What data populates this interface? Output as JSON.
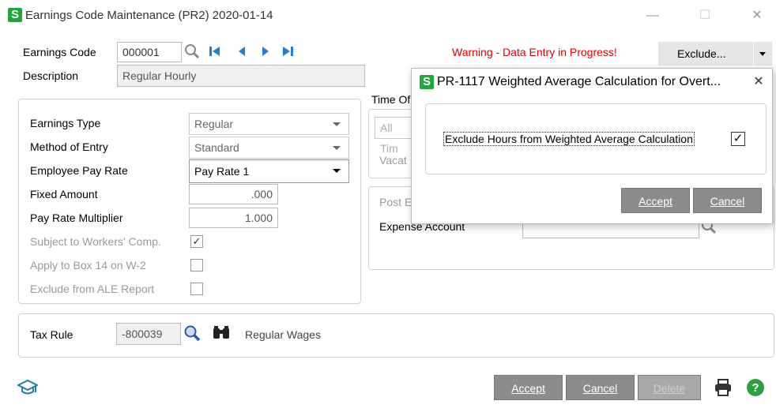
{
  "window": {
    "title": "Earnings Code Maintenance (PR2) 2020-01-14",
    "logo": "S",
    "minimize": "—",
    "maximize": "☐",
    "close": "✕"
  },
  "header": {
    "earnings_code_label": "Earnings Code",
    "earnings_code_value": "000001",
    "description_label": "Description",
    "description_value": "Regular Hourly",
    "warning": "Warning - Data Entry in Progress!",
    "exclude_button": "Exclude..."
  },
  "left_group": {
    "earnings_type_label": "Earnings Type",
    "earnings_type_value": "Regular",
    "method_label": "Method of Entry",
    "method_value": "Standard",
    "pay_rate_label": "Employee Pay Rate",
    "pay_rate_value": "Pay Rate 1",
    "fixed_amount_label": "Fixed Amount",
    "fixed_amount_value": ".000",
    "multiplier_label": "Pay Rate Multiplier",
    "multiplier_value": "1.000",
    "workers_comp_label": "Subject to Workers' Comp.",
    "workers_comp_checked": true,
    "box14_label": "Apply to Box 14 on W-2",
    "box14_checked": false,
    "ale_label": "Exclude from ALE Report",
    "ale_checked": false
  },
  "right_partial": {
    "time_off_label": "Time Of",
    "time_off_value": "All Tim",
    "vacation_label": "Vacat",
    "post_label": "Post E",
    "expense_account_label": "Expense Account"
  },
  "tax": {
    "label": "Tax Rule",
    "code": "-800039",
    "description": "Regular Wages"
  },
  "footer": {
    "accept": "Accept",
    "cancel": "Cancel",
    "delete": "Delete"
  },
  "dialog": {
    "logo": "S",
    "title": "PR-1117 Weighted Average Calculation for Overt...",
    "close": "✕",
    "checkbox_label": "Exclude Hours from Weighted Average Calculation",
    "checkbox_checked": true,
    "accept": "Accept",
    "cancel": "Cancel"
  },
  "colors": {
    "sage_green": "#1fa83a",
    "warning_red": "#e00000",
    "nav_blue": "#1f7fd6",
    "button_gray": "#8c8c8c"
  }
}
